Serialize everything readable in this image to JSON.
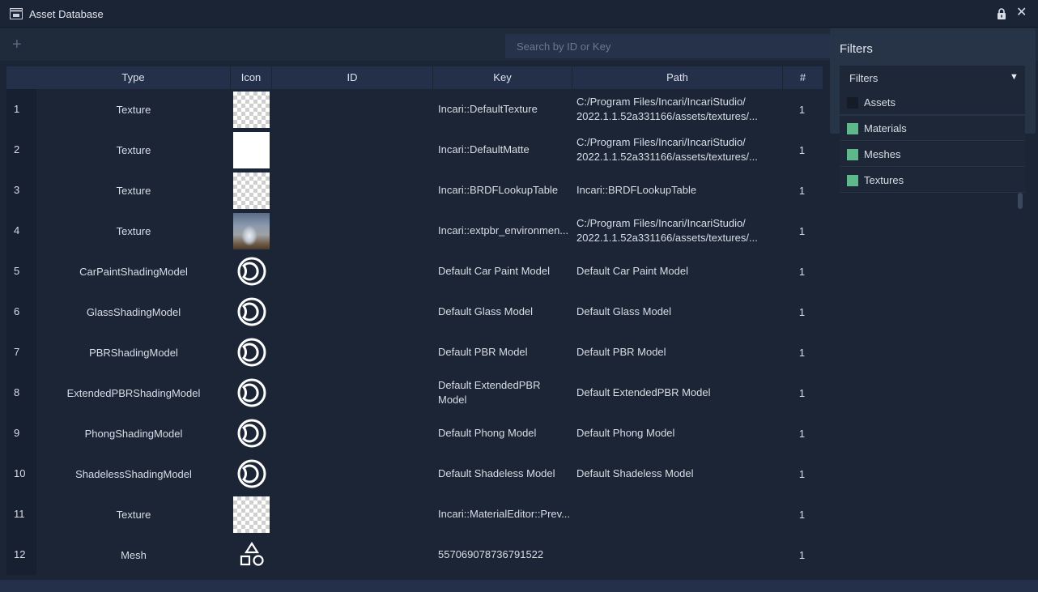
{
  "window": {
    "title": "Asset Database",
    "app_icon": "database-icon",
    "lock_icon": "lock-icon",
    "close_glyph": "✕"
  },
  "toolbar": {
    "add_glyph": "+",
    "search_placeholder": "Search by ID or Key"
  },
  "table": {
    "columns": [
      "Type",
      "Icon",
      "ID",
      "Key",
      "Path",
      "#"
    ],
    "rows": [
      {
        "num": "1",
        "type": "Texture",
        "icon": "checker",
        "id": "",
        "key": "Incari::DefaultTexture",
        "path1": "C:/Program Files/Incari/IncariStudio/",
        "path2": "2022.1.1.52a331166/assets/textures/...",
        "count": "1"
      },
      {
        "num": "2",
        "type": "Texture",
        "icon": "white",
        "id": "",
        "key": "Incari::DefaultMatte",
        "path1": "C:/Program Files/Incari/IncariStudio/",
        "path2": "2022.1.1.52a331166/assets/textures/...",
        "count": "1"
      },
      {
        "num": "3",
        "type": "Texture",
        "icon": "checker",
        "id": "",
        "key": "Incari::BRDFLookupTable",
        "path1": "Incari::BRDFLookupTable",
        "path2": "",
        "count": "1"
      },
      {
        "num": "4",
        "type": "Texture",
        "icon": "env",
        "id": "",
        "key": "Incari::extpbr_environmen...",
        "path1": "C:/Program Files/Incari/IncariStudio/",
        "path2": "2022.1.1.52a331166/assets/textures/...",
        "count": "1"
      },
      {
        "num": "5",
        "type": "CarPaintShadingModel",
        "icon": "shading",
        "id": "",
        "key": "Default Car Paint Model",
        "path1": "Default Car Paint Model",
        "path2": "",
        "count": "1"
      },
      {
        "num": "6",
        "type": "GlassShadingModel",
        "icon": "shading",
        "id": "",
        "key": "Default Glass Model",
        "path1": "Default Glass Model",
        "path2": "",
        "count": "1"
      },
      {
        "num": "7",
        "type": "PBRShadingModel",
        "icon": "shading",
        "id": "",
        "key": "Default PBR Model",
        "path1": "Default PBR Model",
        "path2": "",
        "count": "1"
      },
      {
        "num": "8",
        "type": "ExtendedPBRShadingModel",
        "icon": "shading",
        "id": "",
        "key": "Default ExtendedPBR",
        "key2": "Model",
        "path1": "Default ExtendedPBR Model",
        "path2": "",
        "count": "1"
      },
      {
        "num": "9",
        "type": "PhongShadingModel",
        "icon": "shading",
        "id": "",
        "key": "Default Phong Model",
        "path1": "Default Phong Model",
        "path2": "",
        "count": "1"
      },
      {
        "num": "10",
        "type": "ShadelessShadingModel",
        "icon": "shading",
        "id": "",
        "key": "Default Shadeless Model",
        "path1": "Default Shadeless Model",
        "path2": "",
        "count": "1"
      },
      {
        "num": "11",
        "type": "Texture",
        "icon": "checker",
        "id": "",
        "key": "Incari::MaterialEditor::Prev...",
        "path1": "",
        "path2": "",
        "count": "1"
      },
      {
        "num": "12",
        "type": "Mesh",
        "icon": "mesh",
        "id": "",
        "key": "557069078736791522",
        "path1": "",
        "path2": "",
        "count": "1"
      }
    ]
  },
  "filters": {
    "heading": "Filters",
    "dropdown_label": "Filters",
    "caret_glyph": "▼",
    "options": [
      {
        "label": "Assets",
        "checked": false
      },
      {
        "label": "Materials",
        "checked": true
      },
      {
        "label": "Meshes",
        "checked": true
      },
      {
        "label": "Textures",
        "checked": true
      }
    ]
  },
  "colors": {
    "background": "#1b2535",
    "header": "#243049",
    "checkbox_on": "#5fb88c"
  }
}
